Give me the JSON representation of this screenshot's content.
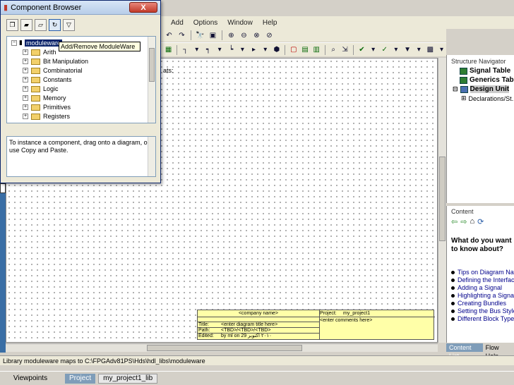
{
  "menu": [
    "Add",
    "Options",
    "Window",
    "Help"
  ],
  "component_browser": {
    "title": "Component Browser",
    "close_label": "X",
    "root": "moduleware",
    "tooltip": "Add/Remove ModuleWare",
    "libraries": [
      "Arith",
      "Bit Manipulation",
      "Combinatorial",
      "Constants",
      "Logic",
      "Memory",
      "Primitives",
      "Registers"
    ],
    "description": "To instance a component, drag onto a diagram, or use Copy and Paste."
  },
  "canvas": {
    "partial_label": "ats:"
  },
  "title_block": {
    "company": "<company name>",
    "project_label": "Project:",
    "project_value": "my_project1",
    "comments": "<enter comments here>",
    "title_label": "Title:",
    "title_value": "<enter diagram title here>",
    "path_label": "Path:",
    "path_value": "<TBD>/<TBD>/<TBD>",
    "edited_label": "Edited:",
    "edited_value": "by ml on 29 ٢٠١٠ اكتوبر"
  },
  "structure_navigator": {
    "title": "Structure Navigator",
    "items": [
      "Signal Table",
      "Generics Table",
      "Design Unit",
      "Declarations/St..."
    ]
  },
  "content_pane": {
    "title": "Content",
    "question": "What do you want to know about?",
    "links": [
      "Tips on Diagram Nav...",
      "Defining the Interface",
      "Adding a Signal",
      "Highlighting a Signal",
      "Creating Bundles",
      "Setting the Bus Style",
      "Different Block Types"
    ],
    "tabs": [
      "Content List",
      "Flow Help"
    ]
  },
  "status": "Library moduleware maps to C:\\FPGAdv81PS\\Hds\\hdl_libs\\moduleware",
  "taskbar": {
    "viewpoints": "Viewpoints",
    "project": "Project",
    "lib": "my_project1_lib"
  }
}
